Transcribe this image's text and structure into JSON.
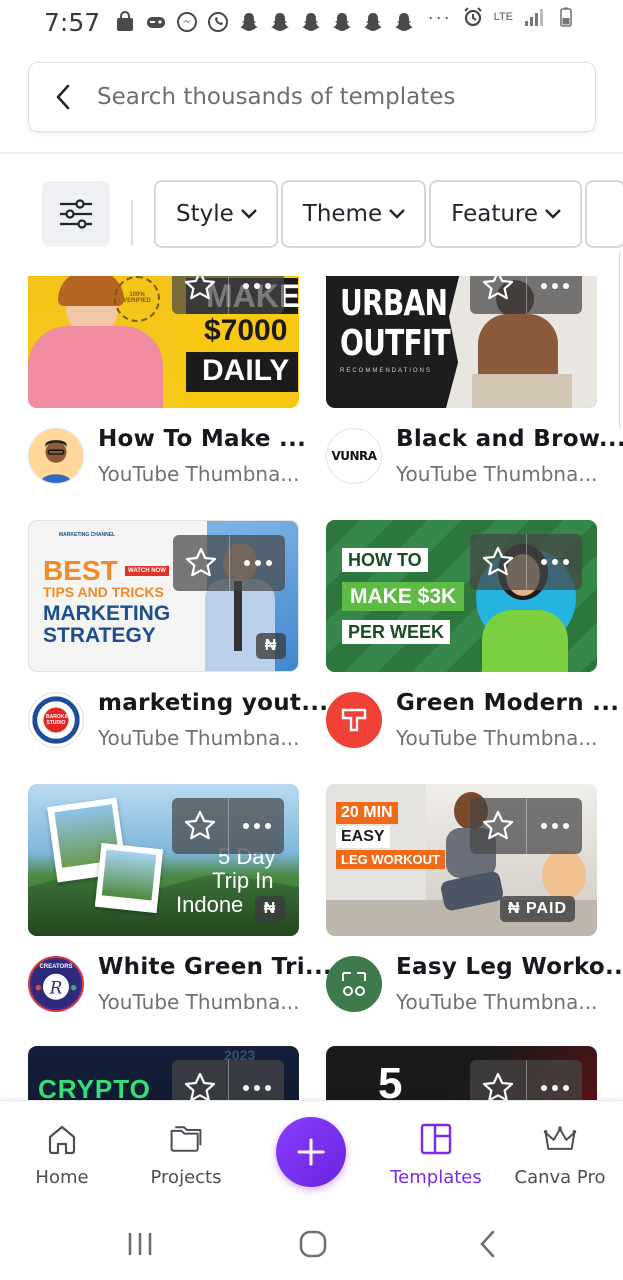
{
  "status_bar": {
    "time": "7:57",
    "icons": [
      "bag-icon",
      "game-icon",
      "messenger-icon",
      "whatsapp-icon",
      "snapchat-icon",
      "snapchat-icon",
      "snapchat-icon",
      "snapchat-icon",
      "snapchat-icon",
      "snapchat-icon"
    ],
    "more": "···",
    "network": "LTE"
  },
  "search": {
    "placeholder": "Search thousands of templates"
  },
  "filters": {
    "chips": [
      {
        "label": "Style"
      },
      {
        "label": "Theme"
      },
      {
        "label": "Feature"
      }
    ]
  },
  "templates": [
    {
      "title": "How To Make ...",
      "subtitle": "YouTube Thumbna...",
      "thumb_text": [
        "MAKE",
        "$7000",
        "DAILY",
        "100% VERIFIED"
      ],
      "badge": ""
    },
    {
      "title": "Black and Brow...",
      "subtitle": "YouTube Thumbna...",
      "thumb_text": [
        "URBAN",
        "OUTFIT",
        "RECOMMENDATIONS"
      ],
      "badge": "",
      "avatar_text": "VUNRA"
    },
    {
      "title": "marketing yout...",
      "subtitle": "YouTube Thumbna...",
      "thumb_text": [
        "MARKETING CHANNEL",
        "BEST",
        "WATCH NOW",
        "TIPS AND TRICKS",
        "MARKETING",
        "STRATEGY"
      ],
      "badge": "₦",
      "avatar_text": "BAROKAH STUDIO"
    },
    {
      "title": "Green Modern ...",
      "subtitle": "YouTube Thumbna...",
      "thumb_text": [
        "HOW TO",
        "MAKE $3K",
        "PER WEEK"
      ],
      "badge": ""
    },
    {
      "title": "White Green Tri...",
      "subtitle": "YouTube Thumbna...",
      "thumb_text": [
        "5 Day",
        "Trip In",
        "Indone"
      ],
      "badge": "₦",
      "avatar_text": "CREATORS"
    },
    {
      "title": "Easy Leg Worko...",
      "subtitle": "YouTube Thumbna...",
      "thumb_text": [
        "20 MIN",
        "EASY",
        "LEG WORKOUT"
      ],
      "badge": "₦ PAID"
    },
    {
      "title": "",
      "subtitle": "",
      "thumb_text": [
        "CRYPTO",
        "2023"
      ],
      "badge": ""
    },
    {
      "title": "",
      "subtitle": "",
      "thumb_text": [
        "5"
      ],
      "badge": ""
    }
  ],
  "bottom_nav": {
    "items": [
      {
        "label": "Home",
        "icon": "home-icon"
      },
      {
        "label": "Projects",
        "icon": "folder-icon"
      },
      {
        "label": "Templates",
        "icon": "templates-icon",
        "active": true
      },
      {
        "label": "Canva Pro",
        "icon": "crown-icon"
      }
    ],
    "fab_icon": "plus-icon"
  },
  "colors": {
    "accent": "#7d2ae8",
    "text": "#15181d",
    "muted": "#6e727a"
  }
}
